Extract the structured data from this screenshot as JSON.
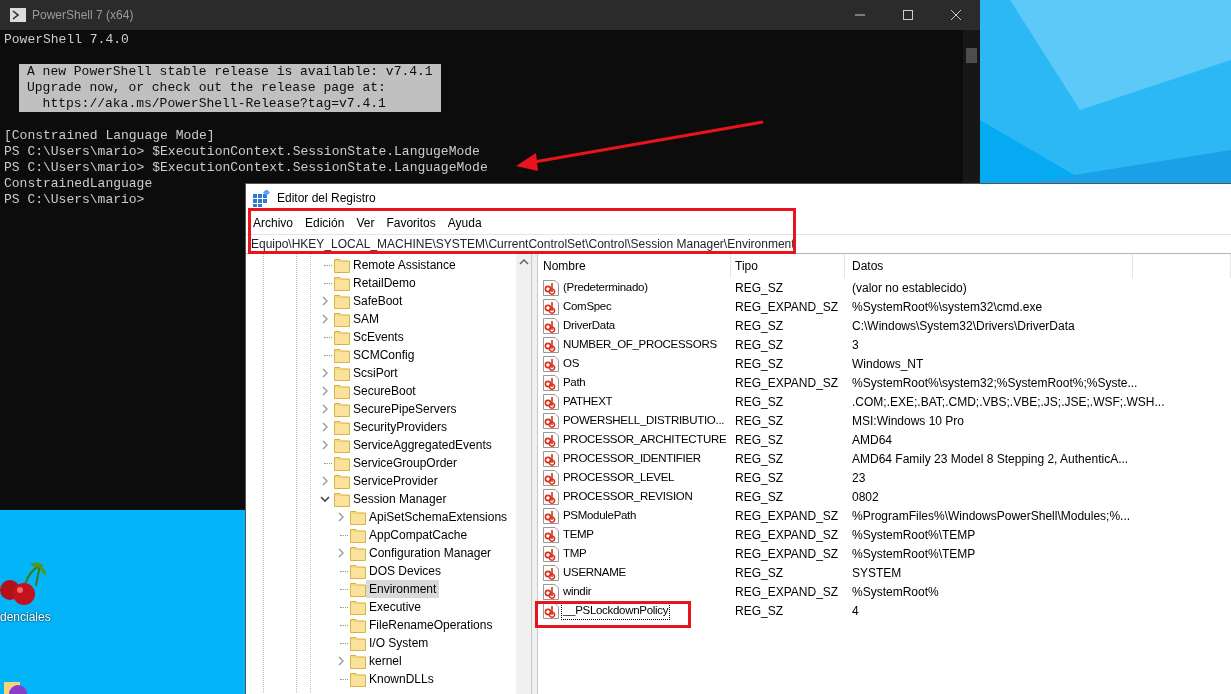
{
  "desktop": {
    "icons": [
      {
        "label": "denciales"
      }
    ]
  },
  "powershell": {
    "title": "PowerShell 7 (x64)",
    "lines": [
      {
        "kind": "text",
        "text": "PowerShell 7.4.0"
      },
      {
        "kind": "blank"
      },
      {
        "kind": "banner",
        "lines": [
          "A new PowerShell stable release is available: v7.4.1",
          "Upgrade now, or check out the release page at:",
          "  https://aka.ms/PowerShell-Release?tag=v7.4.1"
        ]
      },
      {
        "kind": "blank"
      },
      {
        "kind": "text",
        "text": "[Constrained Language Mode]"
      },
      {
        "kind": "text",
        "text": "PS C:\\Users\\mario> $ExecutionContext.SessionState.LangugeMode"
      },
      {
        "kind": "text",
        "text": "PS C:\\Users\\mario> $ExecutionContext.SessionState.LanguageMode"
      },
      {
        "kind": "text",
        "text": "ConstrainedLanguage"
      },
      {
        "kind": "text",
        "text": "PS C:\\Users\\mario>"
      }
    ]
  },
  "registry": {
    "title": "Editor del Registro",
    "menu": [
      "Archivo",
      "Edición",
      "Ver",
      "Favoritos",
      "Ayuda"
    ],
    "address": "Equipo\\HKEY_LOCAL_MACHINE\\SYSTEM\\CurrentControlSet\\Control\\Session Manager\\Environment",
    "tree": [
      {
        "label": "Remote Assistance",
        "has_children": false,
        "selected": false
      },
      {
        "label": "RetailDemo",
        "has_children": false,
        "selected": false
      },
      {
        "label": "SafeBoot",
        "has_children": true,
        "selected": false
      },
      {
        "label": "SAM",
        "has_children": true,
        "selected": false
      },
      {
        "label": "ScEvents",
        "has_children": false,
        "selected": false
      },
      {
        "label": "SCMConfig",
        "has_children": false,
        "selected": false
      },
      {
        "label": "ScsiPort",
        "has_children": true,
        "selected": false
      },
      {
        "label": "SecureBoot",
        "has_children": true,
        "selected": false
      },
      {
        "label": "SecurePipeServers",
        "has_children": true,
        "selected": false
      },
      {
        "label": "SecurityProviders",
        "has_children": true,
        "selected": false
      },
      {
        "label": "ServiceAggregatedEvents",
        "has_children": true,
        "selected": false
      },
      {
        "label": "ServiceGroupOrder",
        "has_children": false,
        "selected": false
      },
      {
        "label": "ServiceProvider",
        "has_children": true,
        "selected": false
      },
      {
        "label": "Session Manager",
        "has_children": true,
        "expanded": true,
        "selected": false,
        "children": [
          {
            "label": "ApiSetSchemaExtensions",
            "has_children": true,
            "selected": false
          },
          {
            "label": "AppCompatCache",
            "has_children": false,
            "selected": false
          },
          {
            "label": "Configuration Manager",
            "has_children": true,
            "selected": false
          },
          {
            "label": "DOS Devices",
            "has_children": false,
            "selected": false
          },
          {
            "label": "Environment",
            "has_children": false,
            "selected": true
          },
          {
            "label": "Executive",
            "has_children": false,
            "selected": false
          },
          {
            "label": "FileRenameOperations",
            "has_children": false,
            "selected": false
          },
          {
            "label": "I/O System",
            "has_children": false,
            "selected": false
          },
          {
            "label": "kernel",
            "has_children": true,
            "selected": false
          },
          {
            "label": "KnownDLLs",
            "has_children": false,
            "selected": false
          }
        ]
      }
    ],
    "columns": [
      "Nombre",
      "Tipo",
      "Datos"
    ],
    "rows": [
      {
        "name": "(Predeterminado)",
        "type": "REG_SZ",
        "data": "(valor no establecido)",
        "selected": false
      },
      {
        "name": "ComSpec",
        "type": "REG_EXPAND_SZ",
        "data": "%SystemRoot%\\system32\\cmd.exe",
        "selected": false
      },
      {
        "name": "DriverData",
        "type": "REG_SZ",
        "data": "C:\\Windows\\System32\\Drivers\\DriverData",
        "selected": false
      },
      {
        "name": "NUMBER_OF_PROCESSORS",
        "type": "REG_SZ",
        "data": "3",
        "selected": false
      },
      {
        "name": "OS",
        "type": "REG_SZ",
        "data": "Windows_NT",
        "selected": false
      },
      {
        "name": "Path",
        "type": "REG_EXPAND_SZ",
        "data": "%SystemRoot%\\system32;%SystemRoot%;%Syste...",
        "selected": false
      },
      {
        "name": "PATHEXT",
        "type": "REG_SZ",
        "data": ".COM;.EXE;.BAT;.CMD;.VBS;.VBE;.JS;.JSE;.WSF;.WSH...",
        "selected": false
      },
      {
        "name": "POWERSHELL_DISTRIBUTIO...",
        "type": "REG_SZ",
        "data": "MSI:Windows 10 Pro",
        "selected": false
      },
      {
        "name": "PROCESSOR_ARCHITECTURE",
        "type": "REG_SZ",
        "data": "AMD64",
        "selected": false
      },
      {
        "name": "PROCESSOR_IDENTIFIER",
        "type": "REG_SZ",
        "data": "AMD64 Family 23 Model 8 Stepping 2, AuthenticA...",
        "selected": false
      },
      {
        "name": "PROCESSOR_LEVEL",
        "type": "REG_SZ",
        "data": "23",
        "selected": false
      },
      {
        "name": "PROCESSOR_REVISION",
        "type": "REG_SZ",
        "data": "0802",
        "selected": false
      },
      {
        "name": "PSModulePath",
        "type": "REG_EXPAND_SZ",
        "data": "%ProgramFiles%\\WindowsPowerShell\\Modules;%...",
        "selected": false
      },
      {
        "name": "TEMP",
        "type": "REG_EXPAND_SZ",
        "data": "%SystemRoot%\\TEMP",
        "selected": false
      },
      {
        "name": "TMP",
        "type": "REG_EXPAND_SZ",
        "data": "%SystemRoot%\\TEMP",
        "selected": false
      },
      {
        "name": "USERNAME",
        "type": "REG_SZ",
        "data": "SYSTEM",
        "selected": false
      },
      {
        "name": "windir",
        "type": "REG_EXPAND_SZ",
        "data": "%SystemRoot%",
        "selected": false
      },
      {
        "name": "__PSLockdownPolicy",
        "type": "REG_SZ",
        "data": "4",
        "selected": true
      }
    ]
  }
}
